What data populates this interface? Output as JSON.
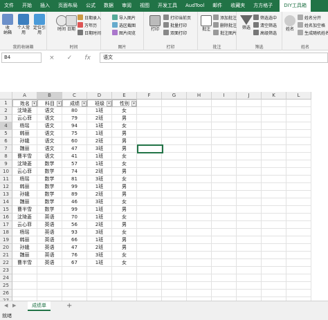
{
  "tabs": [
    "文件",
    "开始",
    "插入",
    "页面布局",
    "公式",
    "数据",
    "审阅",
    "视图",
    "开发工具",
    "AudTool",
    "邮件",
    "收藏夹",
    "方方格子",
    "DIY工具箱"
  ],
  "active_tab_index": 13,
  "ribbon": {
    "group1": {
      "name": "我的收纳箱",
      "btn_collect": "收\n纳箱",
      "btn_personal": "个人常\n用",
      "btn_locate": "定位引\n用"
    },
    "group2": {
      "name": "时间",
      "btn_time": "时间",
      "btn_date": "日期",
      "s1": "日期录入",
      "s2": "万年历",
      "s3": "日期时间"
    },
    "group3": {
      "name": "图片",
      "s1": "导入图片",
      "s2": "选区截图",
      "s3": "图片阅览"
    },
    "group4": {
      "name": "打印",
      "btn_print": "打印",
      "s1": "打印当前页",
      "s2": "批量打印",
      "s3": "双面打印"
    },
    "group5": {
      "name": "批注",
      "btn": "批注",
      "s1": "添加批注",
      "s2": "删除批注",
      "s3": "批注图片"
    },
    "group6": {
      "name": "筛选",
      "btn": "筛选",
      "s1": "筛选选中",
      "s2": "清空筛选",
      "s3": "高级筛选"
    },
    "group7": {
      "name": "姓名",
      "btn": "姓名",
      "s1": "姓名分开",
      "s2": "姓名加空格",
      "s3": "生成随机姓名"
    }
  },
  "formula_bar": {
    "name_box": "B4",
    "cancel": "×",
    "confirm": "✓",
    "fx": "fx",
    "value": "语文"
  },
  "columns": [
    "A",
    "B",
    "C",
    "D",
    "E",
    "F",
    "G",
    "H",
    "I",
    "J",
    "K",
    "L"
  ],
  "headers": [
    "姓名",
    "科目",
    "成绩",
    "班级",
    "性别"
  ],
  "rows": [
    [
      "沈琦菱",
      "语文",
      "80",
      "1班",
      "女"
    ],
    [
      "云心菲",
      "语文",
      "79",
      "2班",
      "男"
    ],
    [
      "杨瑶",
      "语文",
      "94",
      "1班",
      "女"
    ],
    [
      "韩丽",
      "语文",
      "75",
      "1班",
      "男"
    ],
    [
      "孙娥",
      "语文",
      "60",
      "2班",
      "男"
    ],
    [
      "魏丽",
      "语文",
      "47",
      "3班",
      "男"
    ],
    [
      "曹半雪",
      "语文",
      "41",
      "1班",
      "女"
    ],
    [
      "沈琦菱",
      "数学",
      "57",
      "1班",
      "女"
    ],
    [
      "云心菲",
      "数学",
      "74",
      "2班",
      "男"
    ],
    [
      "杨瑶",
      "数学",
      "81",
      "3班",
      "女"
    ],
    [
      "韩丽",
      "数学",
      "99",
      "1班",
      "男"
    ],
    [
      "孙娥",
      "数学",
      "89",
      "2班",
      "男"
    ],
    [
      "魏丽",
      "数学",
      "46",
      "3班",
      "女"
    ],
    [
      "曹半雪",
      "数学",
      "99",
      "1班",
      "男"
    ],
    [
      "沈琦菱",
      "英语",
      "70",
      "1班",
      "女"
    ],
    [
      "云心菲",
      "英语",
      "56",
      "2班",
      "男"
    ],
    [
      "杨瑶",
      "英语",
      "93",
      "3班",
      "女"
    ],
    [
      "韩丽",
      "英语",
      "66",
      "1班",
      "男"
    ],
    [
      "孙娥",
      "英语",
      "47",
      "2班",
      "男"
    ],
    [
      "魏丽",
      "英语",
      "76",
      "3班",
      "女"
    ],
    [
      "曹半雪",
      "英语",
      "67",
      "1班",
      "女"
    ]
  ],
  "row_numbers": [
    "1",
    "2",
    "3",
    "4",
    "5",
    "6",
    "7",
    "8",
    "9",
    "10",
    "11",
    "12",
    "13",
    "14",
    "15",
    "16",
    "17",
    "18",
    "19",
    "20",
    "21",
    "22",
    "23",
    "24",
    "25",
    "26",
    "27"
  ],
  "sheet_tab": "成绩单",
  "add_sheet": "+",
  "status": "就绪",
  "colors": {
    "excel_green": "#217346"
  }
}
